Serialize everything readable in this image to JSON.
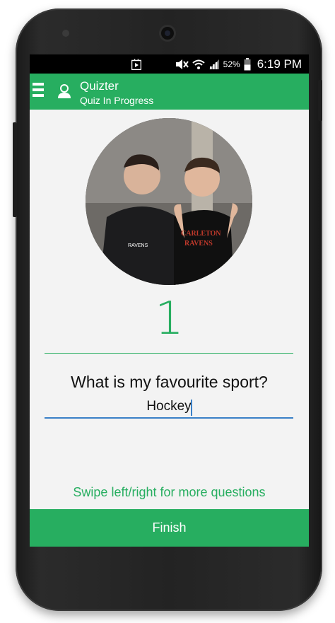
{
  "status_bar": {
    "battery_percent": "52%",
    "time": "6:19 PM",
    "icons": [
      "play-store-icon",
      "mute-icon",
      "wifi-icon",
      "signal-icon",
      "battery-icon"
    ]
  },
  "app_bar": {
    "title": "Quizter",
    "subtitle": "Quiz In Progress",
    "icons": [
      "menu-icon",
      "profile-icon"
    ],
    "color": "#27ae60"
  },
  "quiz": {
    "question_number": "1",
    "question": "What is my favourite sport?",
    "answer": "Hockey",
    "hint": "Swipe left/right for more questions"
  },
  "footer": {
    "finish_label": "Finish"
  },
  "colors": {
    "accent": "#27ae60",
    "input_underline": "#3a80c7",
    "background": "#f3f3f3"
  }
}
